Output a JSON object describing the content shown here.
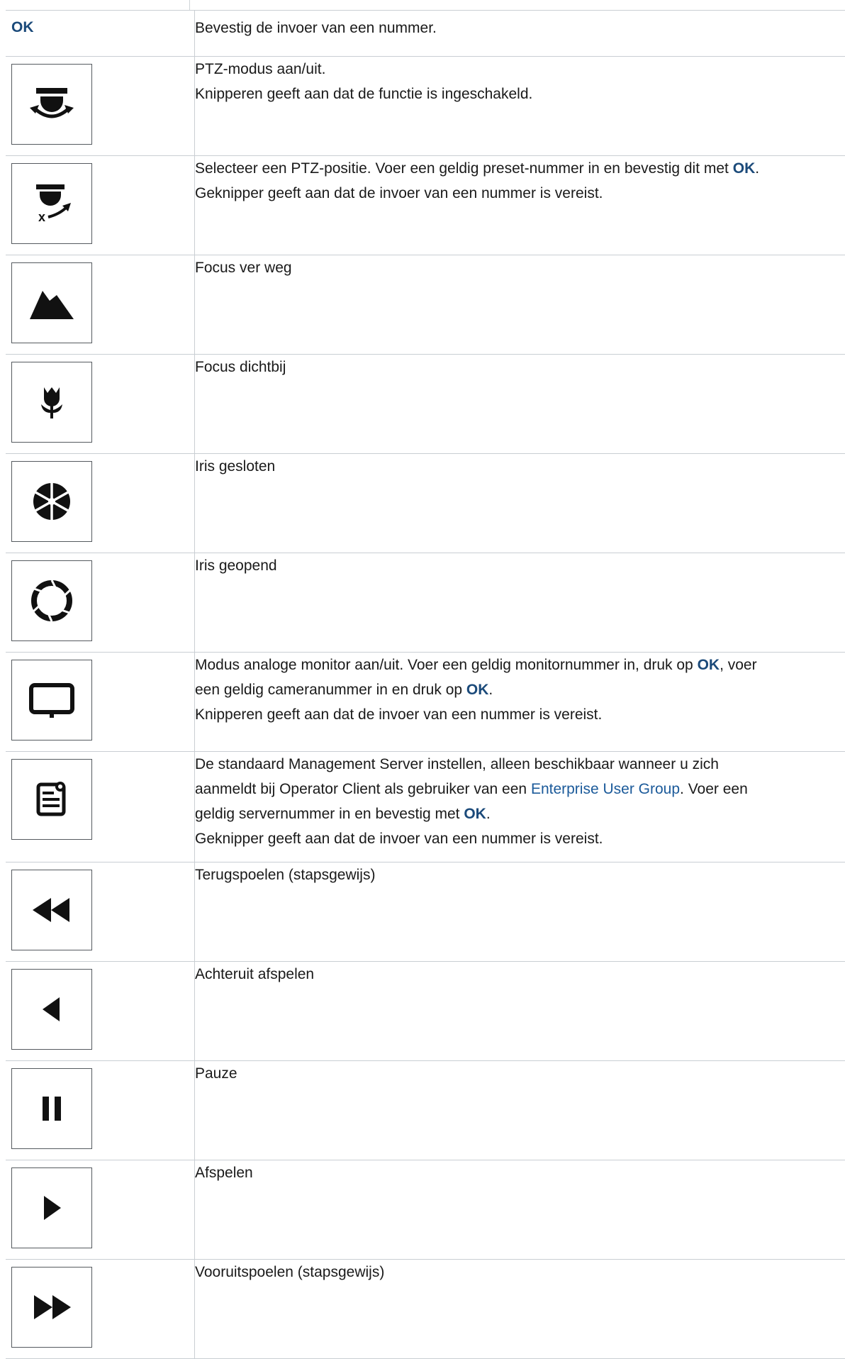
{
  "ok_row": {
    "key": "OK",
    "description": "Bevestig de invoer van een nummer."
  },
  "rows": [
    {
      "icon": "ptz-mode-icon",
      "lines": [
        "PTZ-modus aan/uit.",
        "Knipperen geeft aan dat de functie is ingeschakeld."
      ]
    },
    {
      "icon": "ptz-preset-icon",
      "lines": [
        {
          "parts": [
            "Selecteer een PTZ-positie. Voer een geldig preset-nummer in en bevestig dit met ",
            "OK",
            "."
          ]
        },
        "Geknipper geeft aan dat de invoer van een nummer is vereist."
      ]
    },
    {
      "icon": "focus-far-icon",
      "lines": [
        "Focus ver weg"
      ]
    },
    {
      "icon": "focus-near-icon",
      "lines": [
        "Focus dichtbij"
      ]
    },
    {
      "icon": "iris-closed-icon",
      "lines": [
        "Iris gesloten"
      ]
    },
    {
      "icon": "iris-open-icon",
      "lines": [
        "Iris geopend"
      ]
    },
    {
      "icon": "monitor-icon",
      "lines": [
        {
          "parts": [
            "Modus analoge monitor aan/uit. Voer een geldig monitornummer in, druk op ",
            "OK",
            ", voer"
          ]
        },
        {
          "parts": [
            "een geldig cameranummer in en druk op ",
            "OK",
            "."
          ]
        },
        "Knipperen geeft aan dat de invoer van een nummer is vereist."
      ]
    },
    {
      "icon": "management-server-icon",
      "lines": [
        "De standaard Management Server instellen, alleen beschikbaar wanneer u zich",
        {
          "parts": [
            "aanmeldt bij Operator Client als gebruiker van een ",
            "Enterprise User Group",
            ". Voer een"
          ]
        },
        {
          "parts": [
            "geldig servernummer in en bevestig met ",
            "OK",
            "."
          ]
        },
        "Geknipper geeft aan dat de invoer van een nummer is vereist."
      ]
    },
    {
      "icon": "rewind-step-icon",
      "lines": [
        "Terugspoelen (stapsgewijs)"
      ]
    },
    {
      "icon": "play-reverse-icon",
      "lines": [
        "Achteruit afspelen"
      ]
    },
    {
      "icon": "pause-icon",
      "lines": [
        "Pauze"
      ]
    },
    {
      "icon": "play-icon",
      "lines": [
        "Afspelen"
      ]
    },
    {
      "icon": "fast-forward-step-icon",
      "lines": [
        "Vooruitspoelen (stapsgewijs)"
      ]
    }
  ],
  "colors": {
    "ok_blue": "#1b4a7a",
    "link_blue": "#1b5a9a",
    "border": "#c9ced3"
  }
}
